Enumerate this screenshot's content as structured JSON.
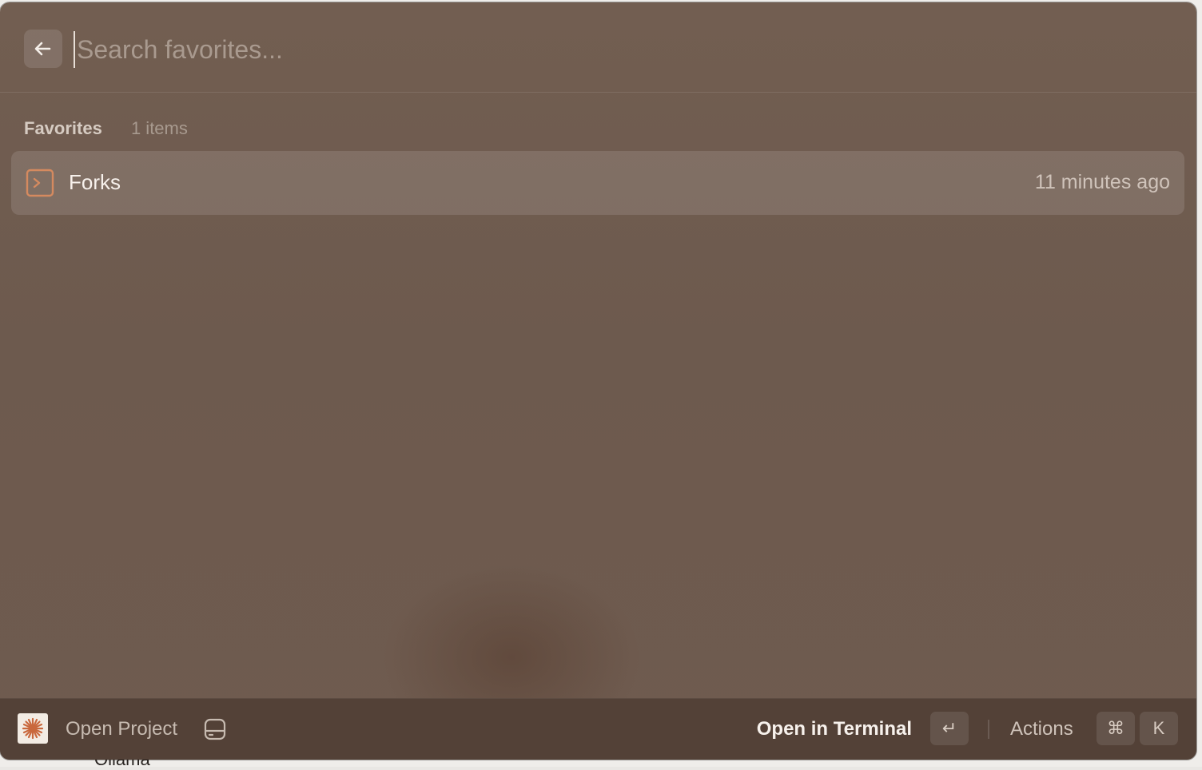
{
  "search": {
    "placeholder": "Search favorites...",
    "value": ""
  },
  "section": {
    "title": "Favorites",
    "count": "1 items"
  },
  "items": [
    {
      "title": "Forks",
      "time": "11 minutes ago",
      "icon": "terminal-prompt-icon"
    }
  ],
  "footer": {
    "open_project_label": "Open Project",
    "primary_action_label": "Open in Terminal",
    "enter_key": "↵",
    "actions_label": "Actions",
    "cmd_key": "⌘",
    "k_key": "K"
  },
  "colors": {
    "window_bg": "#6f5b4f",
    "footer_bg": "#534137",
    "accent_orange": "#d58a5f",
    "text_primary": "#f7f1ec",
    "text_secondary": "#cfc3ba"
  }
}
